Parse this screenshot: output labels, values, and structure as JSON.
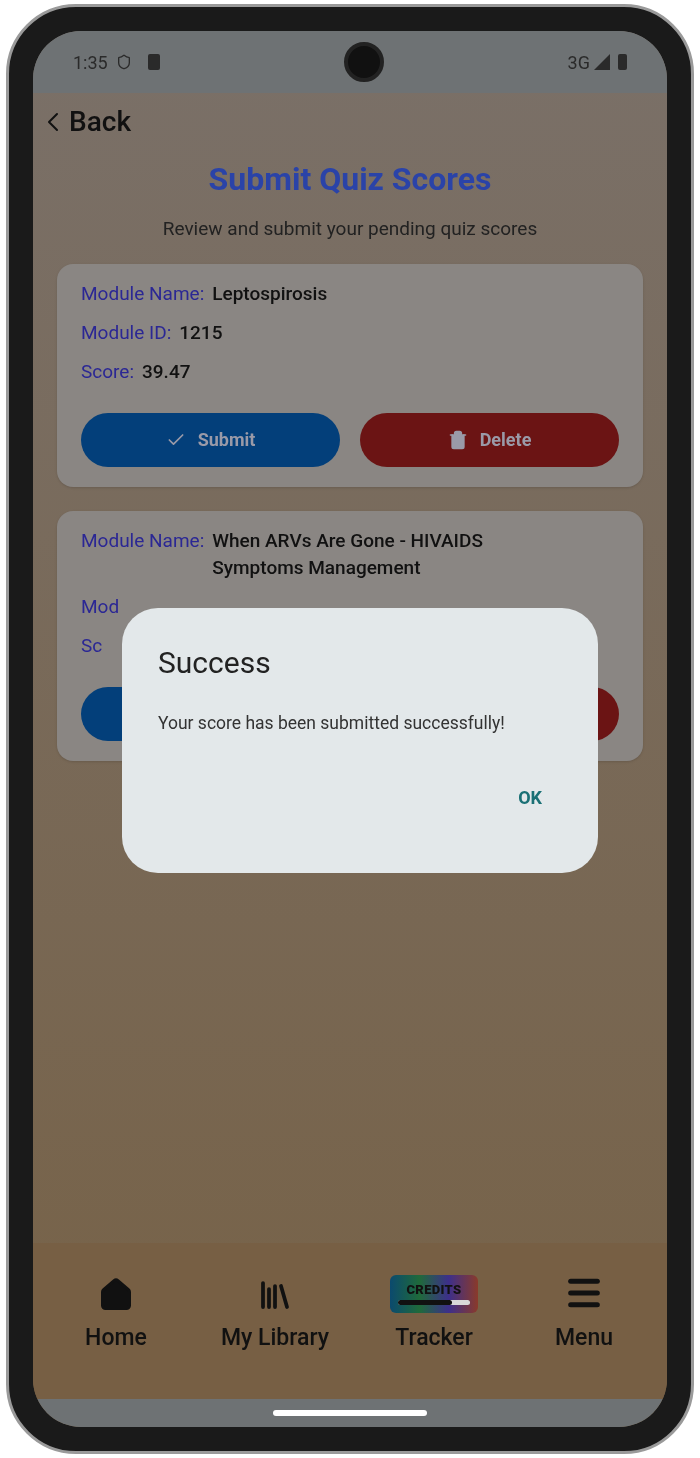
{
  "status_bar": {
    "time": "1:35",
    "network": "3G"
  },
  "back": {
    "label": "Back"
  },
  "title": "Submit Quiz Scores",
  "subtitle": "Review and submit your pending quiz scores",
  "cards": [
    {
      "fields": [
        {
          "label": "Module Name:",
          "value": "Leptospirosis"
        },
        {
          "label": "Module ID:",
          "value": "1215"
        },
        {
          "label": "Score:",
          "value": "39.47"
        }
      ],
      "buttons": [
        {
          "kind": "submit",
          "label": "Submit"
        },
        {
          "kind": "delete",
          "label": "Delete"
        }
      ]
    },
    {
      "fields": [
        {
          "label": "Module Name:",
          "value": "When ARVs Are Gone - HIVAIDS Symptoms Management"
        },
        {
          "label": "Mod"
        },
        {
          "label": "Sc"
        }
      ],
      "buttons": [
        {
          "kind": "submit"
        },
        {
          "kind": "delete"
        }
      ]
    }
  ],
  "dialog": {
    "title": "Success",
    "message": "Your score has been submitted successfully!",
    "action": "OK"
  },
  "nav": [
    {
      "kind": "home",
      "label": "Home"
    },
    {
      "kind": "library",
      "label": "My Library"
    },
    {
      "kind": "credits",
      "label": "Tracker",
      "badge": "CREDITS",
      "level": 0.75
    },
    {
      "kind": "menu",
      "label": "Menu"
    }
  ]
}
